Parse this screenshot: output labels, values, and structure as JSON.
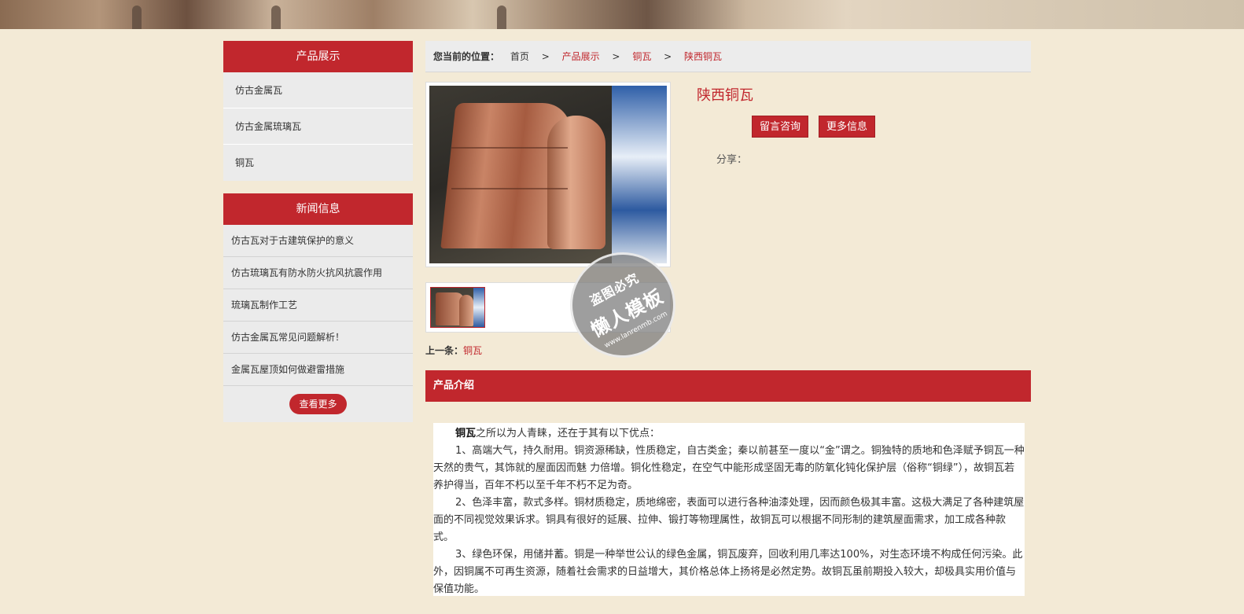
{
  "sidebar": {
    "products": {
      "title": "产品展示",
      "items": [
        "仿古金属瓦",
        "仿古金属琉璃瓦",
        "铜瓦"
      ]
    },
    "news": {
      "title": "新闻信息",
      "items": [
        "仿古瓦对于古建筑保护的意义",
        "仿古琉璃瓦有防水防火抗风抗震作用",
        "琉璃瓦制作工艺",
        "仿古金属瓦常见问题解析！",
        "金属瓦屋顶如何做避雷措施"
      ],
      "more_label": "查看更多"
    }
  },
  "breadcrumb": {
    "label": "您当前的位置：",
    "items": [
      "首页",
      "产品展示",
      "铜瓦",
      "陕西铜瓦"
    ],
    "separator": ">"
  },
  "product": {
    "title": "陕西铜瓦",
    "consult_label": "留言咨询",
    "more_info_label": "更多信息",
    "share_label": "分享："
  },
  "watermark": {
    "line1": "盗图必究",
    "line2": "懒人模板",
    "line3": "www.lanrenmb.com"
  },
  "prev": {
    "label": "上一条：",
    "link": "铜瓦"
  },
  "intro": {
    "title": "产品介绍",
    "lead_bold": "铜瓦",
    "lead_rest": "之所以为人青睐，还在于其有以下优点：",
    "paragraphs": [
      "1、高端大气，持久耐用。铜资源稀缺，性质稳定，自古类金；秦以前甚至一度以“金”谓之。铜独特的质地和色泽赋予铜瓦一种天然的贵气，其饰就的屋面因而魅 力倍增。铜化性稳定，在空气中能形成坚固无毒的防氧化钝化保护层（俗称“铜绿”），故铜瓦若养护得当，百年不朽以至千年不朽不足为奇。",
      "2、色泽丰富，款式多样。铜材质稳定，质地绵密，表面可以进行各种油漆处理，因而颜色极其丰富。这极大满足了各种建筑屋面的不同视觉效果诉求。铜具有很好的延展、拉伸、锻打等物理属性，故铜瓦可以根据不同形制的建筑屋面需求，加工成各种款式。",
      "3、绿色环保，用储并蓄。铜是一种举世公认的绿色金属，铜瓦废弃，回收利用几率达100%，对生态环境不构成任何污染。此外，因铜属不可再生资源，随着社会需求的日益增大，其价格总体上扬将是必然定势。故铜瓦虽前期投入较大，却极具实用价值与保值功能。"
    ]
  },
  "colors": {
    "accent": "#c1272d",
    "page_bg": "#f3ead6",
    "sidebar_bg": "#ebebeb"
  }
}
